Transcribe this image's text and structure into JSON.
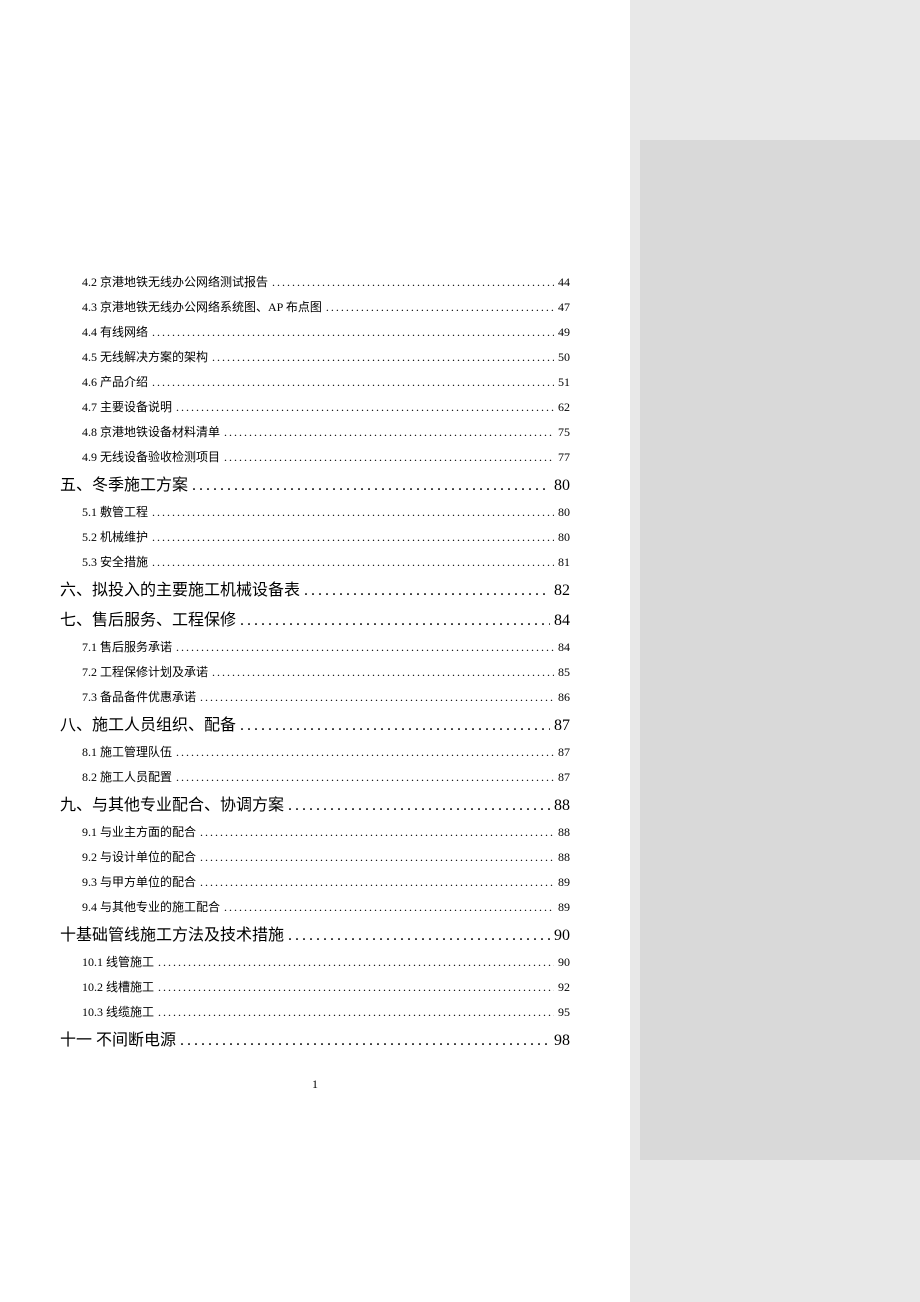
{
  "page_number": "1",
  "toc": [
    {
      "level": 2,
      "title": "4.2 京港地铁无线办公网络测试报告",
      "page": "44"
    },
    {
      "level": 2,
      "title": "4.3 京港地铁无线办公网络系统图、AP 布点图",
      "page": "47"
    },
    {
      "level": 2,
      "title": "4.4 有线网络",
      "page": "49"
    },
    {
      "level": 2,
      "title": "4.5 无线解决方案的架构",
      "page": "50"
    },
    {
      "level": 2,
      "title": "4.6 产品介绍",
      "page": "51"
    },
    {
      "level": 2,
      "title": "4.7 主要设备说明",
      "page": "62"
    },
    {
      "level": 2,
      "title": "4.8 京港地铁设备材料清单",
      "page": "75"
    },
    {
      "level": 2,
      "title": "4.9 无线设备验收检测项目",
      "page": "77"
    },
    {
      "level": 1,
      "title": "五、冬季施工方案",
      "page": "80"
    },
    {
      "level": 2,
      "title": "5.1 敷管工程",
      "page": "80"
    },
    {
      "level": 2,
      "title": "5.2 机械维护",
      "page": "80"
    },
    {
      "level": 2,
      "title": "5.3 安全措施",
      "page": "81"
    },
    {
      "level": 1,
      "title": "六、拟投入的主要施工机械设备表",
      "page": "82"
    },
    {
      "level": 1,
      "title": "七、售后服务、工程保修",
      "page": "84"
    },
    {
      "level": 2,
      "title": "7.1 售后服务承诺",
      "page": "84"
    },
    {
      "level": 2,
      "title": "7.2 工程保修计划及承诺",
      "page": "85"
    },
    {
      "level": 2,
      "title": "7.3 备品备件优惠承诺",
      "page": "86"
    },
    {
      "level": 1,
      "title": "八、施工人员组织、配备",
      "page": "87"
    },
    {
      "level": 2,
      "title": "8.1 施工管理队伍",
      "page": "87"
    },
    {
      "level": 2,
      "title": "8.2 施工人员配置",
      "page": "87"
    },
    {
      "level": 1,
      "title": "九、与其他专业配合、协调方案",
      "page": "88"
    },
    {
      "level": 2,
      "title": "9.1 与业主方面的配合",
      "page": "88"
    },
    {
      "level": 2,
      "title": "9.2 与设计单位的配合",
      "page": "88"
    },
    {
      "level": 2,
      "title": "9.3 与甲方单位的配合",
      "page": "89"
    },
    {
      "level": 2,
      "title": "9.4 与其他专业的施工配合",
      "page": "89"
    },
    {
      "level": 1,
      "title": "十基础管线施工方法及技术措施",
      "page": "90"
    },
    {
      "level": 2,
      "title": "10.1 线管施工",
      "page": "90"
    },
    {
      "level": 2,
      "title": "10.2 线槽施工",
      "page": "92"
    },
    {
      "level": 2,
      "title": "10.3 线缆施工",
      "page": "95"
    },
    {
      "level": 1,
      "title": "十一 不间断电源",
      "page": "98"
    }
  ]
}
